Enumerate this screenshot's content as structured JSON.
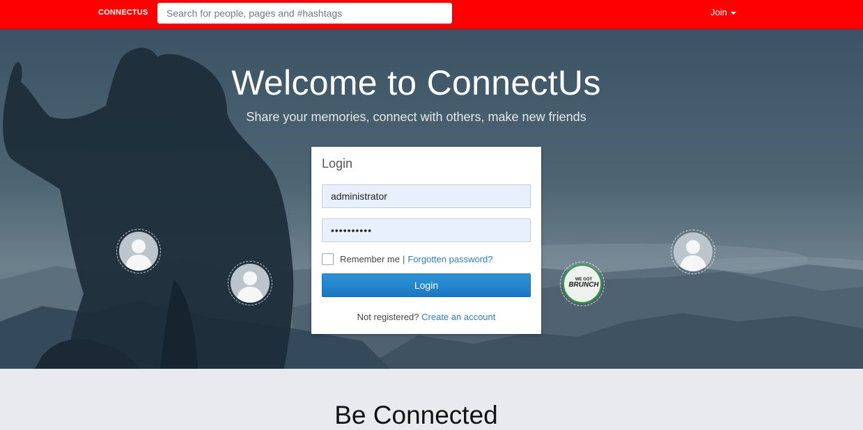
{
  "navbar": {
    "brand": "CONNECTUS",
    "search_placeholder": "Search for people, pages and #hashtags",
    "join_label": "Join"
  },
  "hero": {
    "title": "Welcome to ConnectUs",
    "subtitle": "Share your memories, connect with others, make new friends",
    "bubbles": [
      {
        "kind": "avatar",
        "icon": "default-user-avatar-icon"
      },
      {
        "kind": "avatar",
        "icon": "default-user-avatar-icon"
      },
      {
        "kind": "logo",
        "icon": "we-got-brunch-logo-icon",
        "small_text": "WE GOT",
        "big_text": "BRUNCH"
      },
      {
        "kind": "avatar",
        "icon": "default-user-avatar-icon"
      }
    ]
  },
  "login": {
    "title": "Login",
    "username_value": "administrator",
    "password_value": "••••••••••",
    "remember_label": "Remember me",
    "separator": "|",
    "forgot_label": "Forgotten password?",
    "button_label": "Login",
    "not_registered_text": "Not registered?",
    "create_account_label": "Create an account"
  },
  "section": {
    "title": "Be Connected"
  },
  "colors": {
    "navbar": "#ff0000",
    "primary_button": "#1a78c2",
    "link": "#337ab7",
    "page_background": "#e9eaed"
  }
}
